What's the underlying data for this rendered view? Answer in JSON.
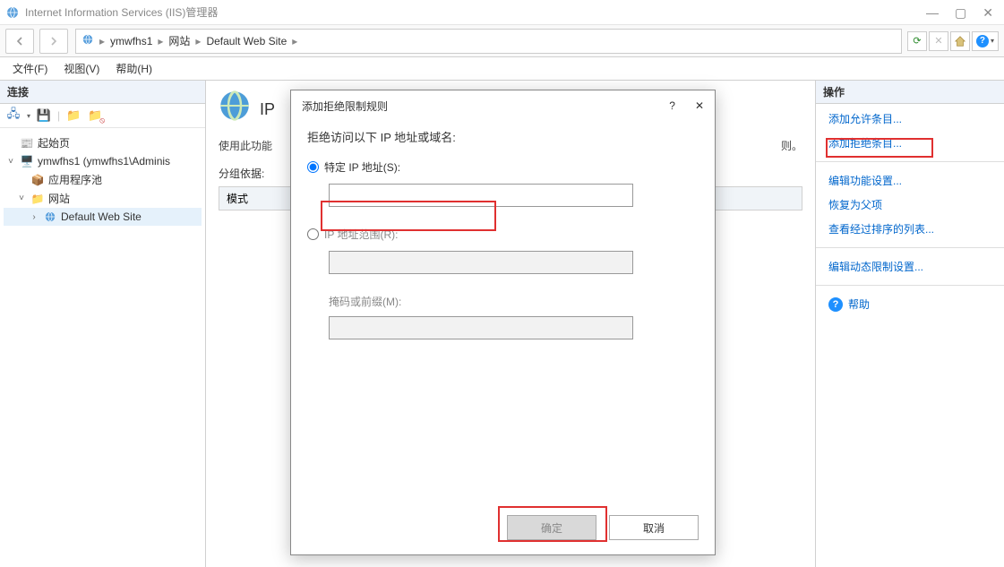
{
  "window": {
    "title": "Internet Information Services (IIS)管理器"
  },
  "breadcrumb": {
    "server": "ymwfhs1",
    "sites": "网站",
    "site": "Default Web Site"
  },
  "menu": {
    "file": "文件(F)",
    "view": "视图(V)",
    "help": "帮助(H)"
  },
  "left_panel": {
    "header": "连接",
    "tree": {
      "start": "起始页",
      "server": "ymwfhs1 (ymwfhs1\\Adminis",
      "app_pools": "应用程序池",
      "sites": "网站",
      "default_site": "Default Web Site"
    }
  },
  "center_panel": {
    "title_prefix": "IP",
    "desc_prefix": "使用此功能",
    "desc_suffix": "则。",
    "group_label": "分组依据:",
    "mode_col": "模式"
  },
  "right_panel": {
    "header": "操作",
    "add_allow": "添加允许条目...",
    "add_deny": "添加拒绝条目...",
    "edit_feature": "编辑功能设置...",
    "revert": "恢复为父项",
    "view_ordered": "查看经过排序的列表...",
    "edit_dynamic": "编辑动态限制设置...",
    "help": "帮助"
  },
  "dialog": {
    "title": "添加拒绝限制规则",
    "header": "拒绝访问以下 IP 地址或域名:",
    "radio_specific": "特定 IP 地址(S):",
    "radio_range": "IP 地址范围(R):",
    "mask_label": "掩码或前缀(M):",
    "ok": "确定",
    "cancel": "取消",
    "specific_value": "",
    "range_value": "",
    "mask_value": ""
  }
}
